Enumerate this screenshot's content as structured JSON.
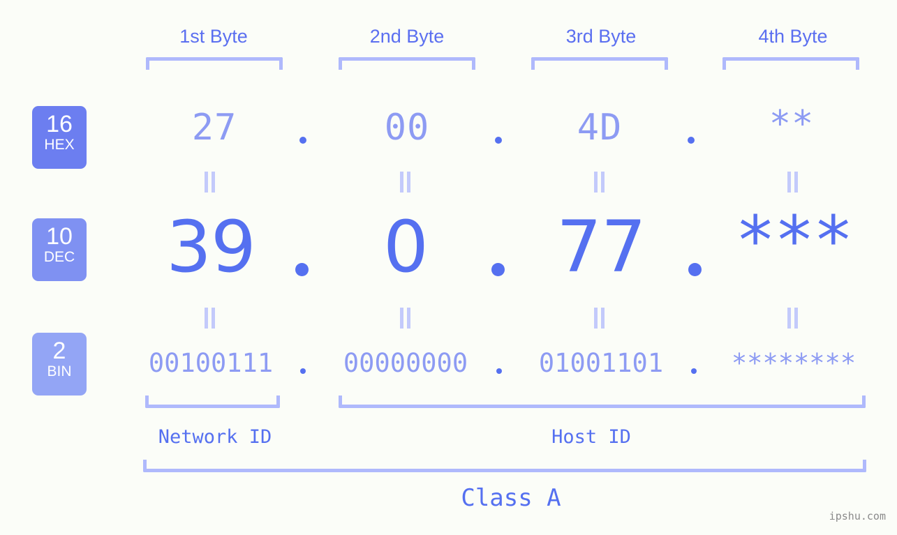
{
  "page": {
    "background_color": "#fbfdf8",
    "accent_color": "#5570f0",
    "accent_light_color": "#8d9bf3",
    "bracket_color": "#afb9fc",
    "watermark": "ipshu.com"
  },
  "byte_headers": [
    {
      "label": "1st Byte"
    },
    {
      "label": "2nd Byte"
    },
    {
      "label": "3rd Byte"
    },
    {
      "label": "4th Byte"
    }
  ],
  "radix_badges": [
    {
      "num": "16",
      "name": "HEX",
      "color": "#6c7ef0"
    },
    {
      "num": "10",
      "name": "DEC",
      "color": "#7f91f2"
    },
    {
      "num": "2",
      "name": "BIN",
      "color": "#93a5f5"
    }
  ],
  "rows": {
    "hex": {
      "radix": "16",
      "radix_name": "HEX",
      "values": [
        "27",
        "00",
        "4D",
        "**"
      ],
      "separator": "."
    },
    "dec": {
      "radix": "10",
      "radix_name": "DEC",
      "values": [
        "39",
        "0",
        "77",
        "***"
      ],
      "separator": "."
    },
    "bin": {
      "radix": "2",
      "radix_name": "BIN",
      "values": [
        "00100111",
        "00000000",
        "01001101",
        "********"
      ],
      "separator": "."
    }
  },
  "equality_marks": {
    "symbol": "=",
    "count_per_gap": 4
  },
  "segments": {
    "network_id": "Network ID",
    "host_id": "Host ID",
    "class": "Class A"
  }
}
